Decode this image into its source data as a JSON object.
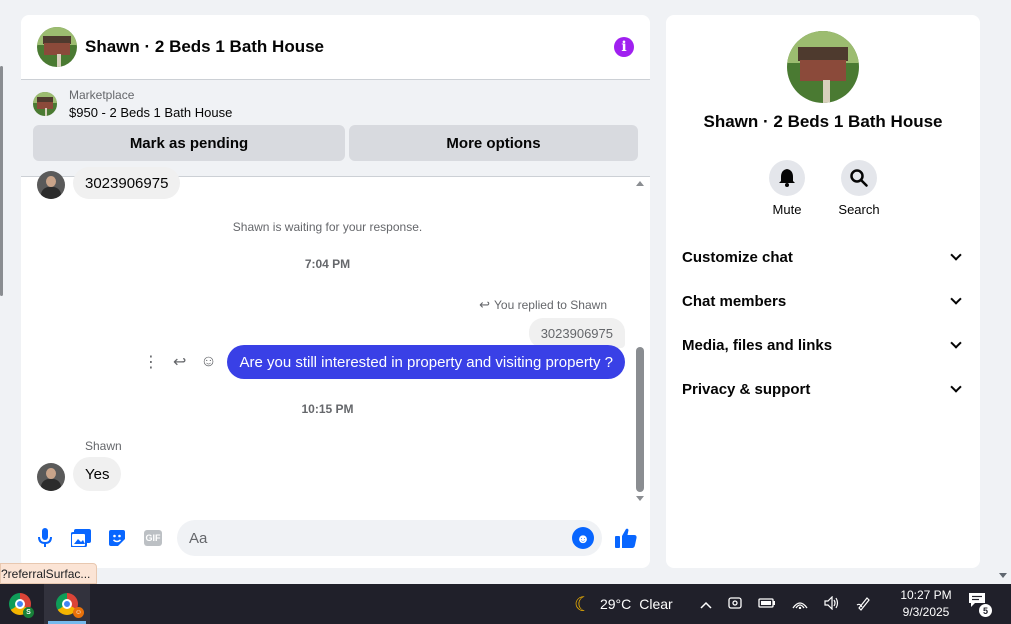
{
  "chat": {
    "title": "Shawn · 2 Beds 1 Bath House",
    "marketplace_label": "Marketplace",
    "listing": "$950 - 2 Beds 1 Bath House",
    "mark_pending": "Mark as pending",
    "more_options": "More options",
    "messages": {
      "phone_incoming": "3023906975",
      "waiting": "Shawn is waiting for your response.",
      "time1": "7:04 PM",
      "replied_to": "You replied to Shawn",
      "quoted": "3023906975",
      "outgoing": "Are you still interested in property and visiting property ?",
      "time2": "10:15 PM",
      "sender": "Shawn",
      "incoming": "Yes"
    },
    "composer_placeholder": "Aa"
  },
  "info_panel": {
    "title": "Shawn · 2 Beds 1 Bath House",
    "mute_label": "Mute",
    "search_label": "Search",
    "sections": [
      "Customize chat",
      "Chat members",
      "Media, files and links",
      "Privacy & support"
    ]
  },
  "status_url": "?referralSurfac...",
  "taskbar": {
    "temperature": "29°C",
    "weather": "Clear",
    "time": "10:27 PM",
    "date": "9/3/2025",
    "notification_count": "5"
  },
  "colors": {
    "accent": "#0866ff",
    "outgoing_bubble": "#3940e6",
    "info_icon": "#a020f0"
  }
}
